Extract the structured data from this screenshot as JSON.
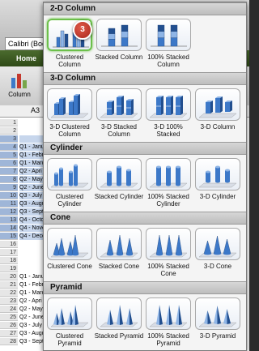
{
  "background": {
    "font_name": "Calibri (Body)",
    "home_tab": "Home",
    "column_button": "Column",
    "name_box": "A3",
    "rows": [
      {
        "num": "1",
        "text": ""
      },
      {
        "num": "2",
        "text": ""
      },
      {
        "num": "3",
        "text": "",
        "sel": true
      },
      {
        "num": "4",
        "text": "Q1 - Janu",
        "sel": true
      },
      {
        "num": "5",
        "text": "Q1 - Febr",
        "sel": true
      },
      {
        "num": "6",
        "text": "Q1 - Marc",
        "sel": true
      },
      {
        "num": "7",
        "text": "Q2 - Apri",
        "sel": true
      },
      {
        "num": "8",
        "text": "Q2 - May",
        "sel": true
      },
      {
        "num": "9",
        "text": "Q2 - June",
        "sel": true
      },
      {
        "num": "10",
        "text": "Q3 - July",
        "sel": true
      },
      {
        "num": "11",
        "text": "Q3 - Augu",
        "sel": true
      },
      {
        "num": "12",
        "text": "Q3 - Sept",
        "sel": true
      },
      {
        "num": "13",
        "text": "Q4 - Octo",
        "sel": true
      },
      {
        "num": "14",
        "text": "Q4 - Nove",
        "sel": true
      },
      {
        "num": "15",
        "text": "Q4 - Dece",
        "sel": true
      },
      {
        "num": "16",
        "text": ""
      },
      {
        "num": "17",
        "text": ""
      },
      {
        "num": "18",
        "text": ""
      },
      {
        "num": "19",
        "text": ""
      },
      {
        "num": "20",
        "text": "Q1 - Janu"
      },
      {
        "num": "21",
        "text": "Q1 - Febr"
      },
      {
        "num": "22",
        "text": "Q1 - Marc"
      },
      {
        "num": "23",
        "text": "Q2 - Apri"
      },
      {
        "num": "24",
        "text": "Q2 - May"
      },
      {
        "num": "25",
        "text": "Q2 - June"
      },
      {
        "num": "26",
        "text": "Q3 - July"
      },
      {
        "num": "27",
        "text": "Q3 - Augu"
      },
      {
        "num": "28",
        "text": "Q3 - Sept"
      }
    ]
  },
  "badge": "3",
  "sections": [
    {
      "title": "2-D Column",
      "items": [
        {
          "label": "Clustered Column",
          "icon": "clustered-column-icon",
          "kind": "col2d-clustered"
        },
        {
          "label": "Stacked Column",
          "icon": "stacked-column-icon",
          "kind": "col2d-stacked"
        },
        {
          "label": "100% Stacked Column",
          "icon": "100-stacked-column-icon",
          "kind": "col2d-100"
        }
      ]
    },
    {
      "title": "3-D Column",
      "items": [
        {
          "label": "3-D Clustered Column",
          "icon": "3d-clustered-column-icon",
          "kind": "col3d-clustered"
        },
        {
          "label": "3-D Stacked Column",
          "icon": "3d-stacked-column-icon",
          "kind": "col3d-stacked"
        },
        {
          "label": "3-D 100% Stacked",
          "icon": "3d-100-stacked-column-icon",
          "kind": "col3d-100"
        },
        {
          "label": "3-D Column",
          "icon": "3d-column-icon",
          "kind": "col3d"
        }
      ]
    },
    {
      "title": "Cylinder",
      "items": [
        {
          "label": "Clustered Cylinder",
          "icon": "clustered-cylinder-icon",
          "kind": "cyl-clustered"
        },
        {
          "label": "Stacked Cylinder",
          "icon": "stacked-cylinder-icon",
          "kind": "cyl-stacked"
        },
        {
          "label": "100% Stacked Cylinder",
          "icon": "100-stacked-cylinder-icon",
          "kind": "cyl-100"
        },
        {
          "label": "3-D Cylinder",
          "icon": "3d-cylinder-icon",
          "kind": "cyl3d"
        }
      ]
    },
    {
      "title": "Cone",
      "items": [
        {
          "label": "Clustered Cone",
          "icon": "clustered-cone-icon",
          "kind": "cone-clustered"
        },
        {
          "label": "Stacked Cone",
          "icon": "stacked-cone-icon",
          "kind": "cone-stacked"
        },
        {
          "label": "100% Stacked Cone",
          "icon": "100-stacked-cone-icon",
          "kind": "cone-100"
        },
        {
          "label": "3-D Cone",
          "icon": "3d-cone-icon",
          "kind": "cone3d"
        }
      ]
    },
    {
      "title": "Pyramid",
      "items": [
        {
          "label": "Clustered Pyramid",
          "icon": "clustered-pyramid-icon",
          "kind": "pyr-clustered"
        },
        {
          "label": "Stacked Pyramid",
          "icon": "stacked-pyramid-icon",
          "kind": "pyr-stacked"
        },
        {
          "label": "100% Stacked Pyramid",
          "icon": "100-stacked-pyramid-icon",
          "kind": "pyr-100"
        },
        {
          "label": "3-D Pyramid",
          "icon": "3d-pyramid-icon",
          "kind": "pyr3d"
        }
      ]
    }
  ]
}
